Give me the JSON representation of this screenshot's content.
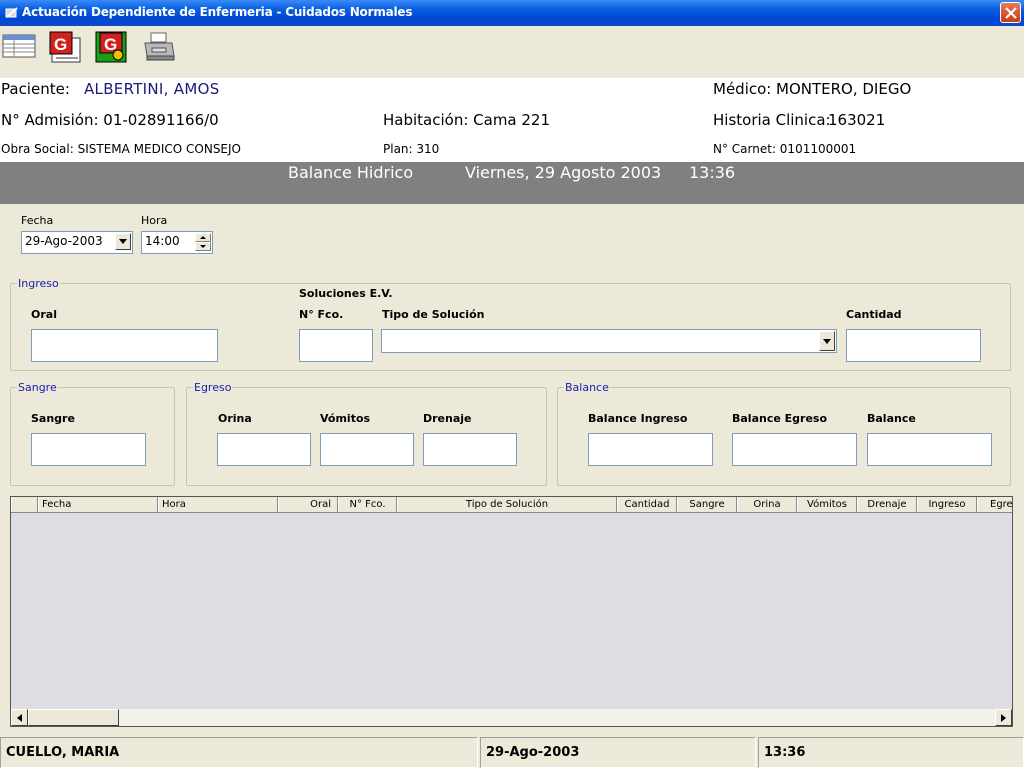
{
  "window": {
    "title": "Actuación Dependiente de Enfermeria - Cuidados Normales"
  },
  "toolbar": {
    "buttons": [
      {
        "name": "list-view",
        "icon": "table-icon"
      },
      {
        "name": "graph-1",
        "icon": "graph-g-icon"
      },
      {
        "name": "graph-2",
        "icon": "graph-g-alt-icon"
      },
      {
        "name": "print",
        "icon": "printer-icon"
      }
    ]
  },
  "patient": {
    "name_label": "Paciente:",
    "name_value": "ALBERTINI, AMOS",
    "doctor_label": "Médico:",
    "doctor_value": "MONTERO, DIEGO",
    "admission": "N° Admisión: 01-02891166/0",
    "room": "Habitación: Cama 221",
    "history_label": "Historia Clinica:",
    "history_value": "163021",
    "insurance": "Obra Social: SISTEMA MEDICO CONSEJO",
    "plan": "Plan: 310",
    "card": "N° Carnet: 0101100001"
  },
  "banner": {
    "title": "Balance Hidrico",
    "date": "Viernes, 29 Agosto 2003",
    "time": "13:36"
  },
  "filters": {
    "date_label": "Fecha",
    "date_value": "29-Ago-2003",
    "time_label": "Hora",
    "time_value": "14:00"
  },
  "ingreso": {
    "legend": "Ingreso",
    "oral_label": "Oral",
    "soluciones_label": "Soluciones E.V.",
    "nfco_label": "N° Fco.",
    "tipo_label": "Tipo de Solución",
    "cantidad_label": "Cantidad"
  },
  "sangre": {
    "legend": "Sangre",
    "sangre_label": "Sangre"
  },
  "egreso": {
    "legend": "Egreso",
    "orina_label": "Orina",
    "vomitos_label": "Vómitos",
    "drenaje_label": "Drenaje"
  },
  "balance": {
    "legend": "Balance",
    "ingreso_label": "Balance Ingreso",
    "egreso_label": "Balance Egreso",
    "balance_label": "Balance"
  },
  "grid": {
    "columns": [
      "",
      "Fecha",
      "Hora",
      "Oral",
      "N° Fco.",
      "Tipo de Solución",
      "Cantidad",
      "Sangre",
      "Orina",
      "Vómitos",
      "Drenaje",
      "Ingreso",
      "Egre"
    ],
    "rows": []
  },
  "statusbar": {
    "user": "CUELLO, MARIA",
    "date": "29-Ago-2003",
    "time": "13:36"
  }
}
